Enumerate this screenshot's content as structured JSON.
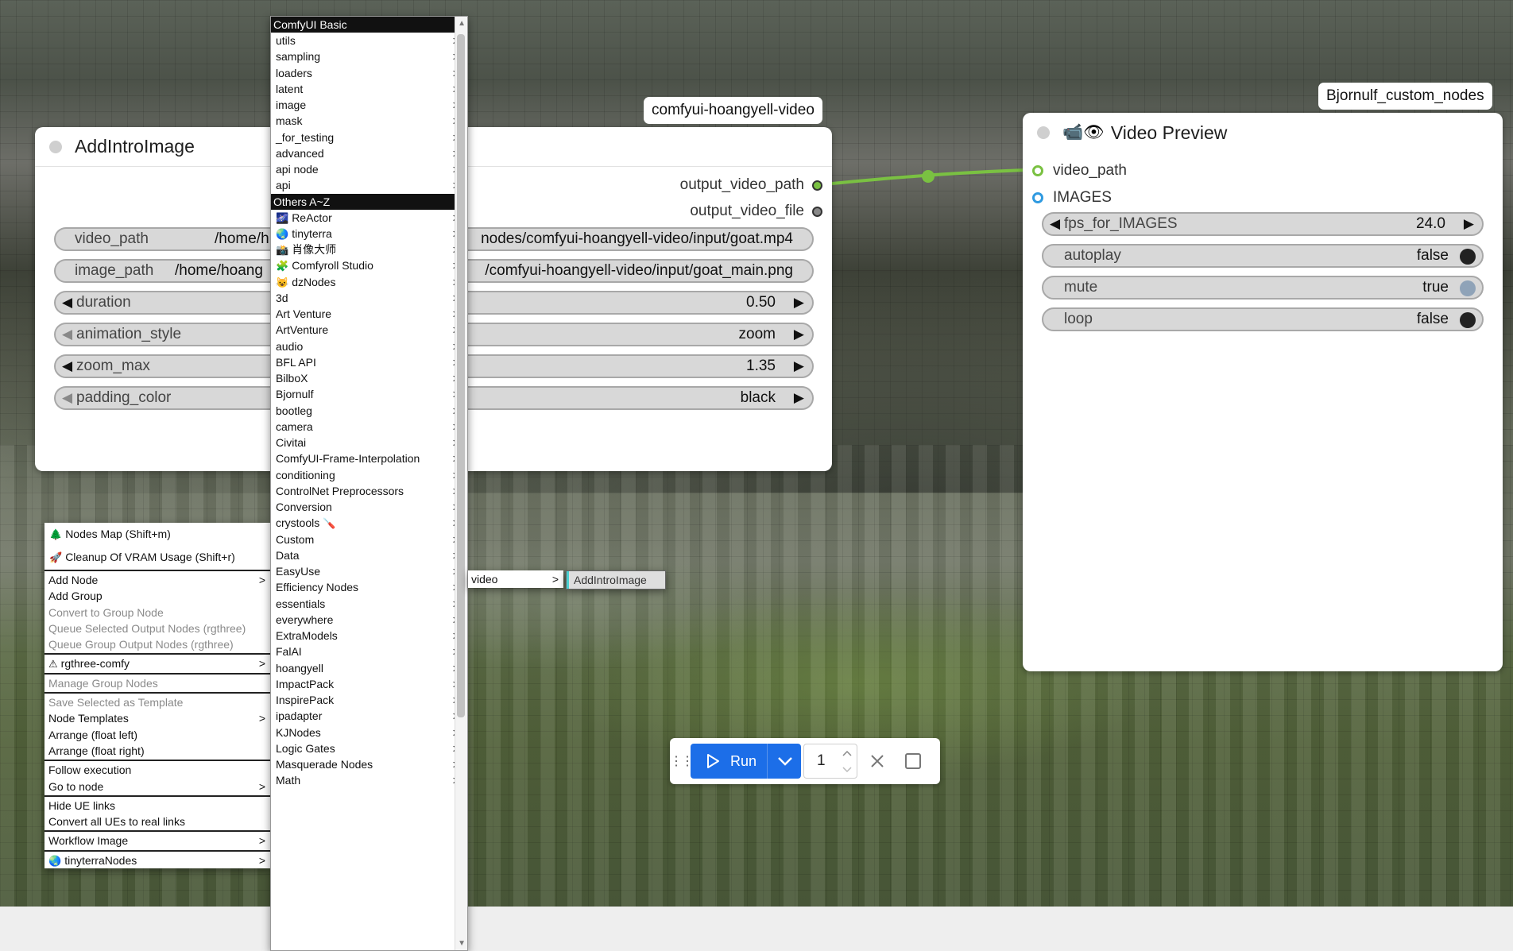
{
  "colors": {
    "link_green": "#7ac142",
    "images_blue": "#2f9ae0",
    "run_blue": "#1c6ee8",
    "menu_accent": "#4ad0d0"
  },
  "nodes": {
    "add_intro": {
      "title": "AddIntroImage",
      "badge": "comfyui-hoangyell-video",
      "outputs": [
        "output_video_path",
        "output_video_file"
      ],
      "widgets": [
        {
          "label": "video_path",
          "value": "/home/hoangyell/ComfyUI/custom_nodes/comfyui-hoangyell-video/input/goat.mp4",
          "visible_left": "/home/h",
          "visible_right": "nodes/comfyui-hoangyell-video/input/goat.mp4"
        },
        {
          "label": "image_path",
          "value": "/home/hoangyell/ComfyUI/custom_nodes/comfyui-hoangyell-video/input/goat_main.png",
          "visible_left": "/home/hoang",
          "visible_right": "/comfyui-hoangyell-video/input/goat_main.png"
        },
        {
          "label": "duration",
          "value": "0.50"
        },
        {
          "label": "animation_style",
          "value": "zoom"
        },
        {
          "label": "zoom_max",
          "value": "1.35"
        },
        {
          "label": "padding_color",
          "value": "black"
        }
      ]
    },
    "video_preview": {
      "title": "Video Preview",
      "icons": "📹👁",
      "badge": "Bjornulf_custom_nodes",
      "inputs": [
        "video_path",
        "IMAGES"
      ],
      "fps_label": "fps_for_IMAGES",
      "fps_value": "24.0",
      "toggles": [
        {
          "label": "autoplay",
          "value": "false"
        },
        {
          "label": "mute",
          "value": "true"
        },
        {
          "label": "loop",
          "value": "false"
        }
      ]
    }
  },
  "canvas_menu": {
    "top_items": [
      {
        "label": "Nodes Map (Shift+m)",
        "icon": "🌲"
      },
      {
        "label": "Cleanup Of VRAM Usage (Shift+r)",
        "icon": "🚀"
      }
    ],
    "groups": [
      [
        {
          "label": "Add Node",
          "sub": true
        },
        {
          "label": "Add Group"
        },
        {
          "label": "Convert to Group Node",
          "disabled": true
        },
        {
          "label": "Queue Selected Output Nodes (rgthree)",
          "disabled": true
        },
        {
          "label": "Queue Group Output Nodes (rgthree)",
          "disabled": true
        }
      ],
      [
        {
          "label": "rgthree-comfy",
          "sub": true,
          "icon": "⚠"
        }
      ],
      [
        {
          "label": "Manage Group Nodes",
          "disabled": true
        }
      ],
      [
        {
          "label": "Save Selected as Template",
          "disabled": true
        },
        {
          "label": "Node Templates",
          "sub": true
        },
        {
          "label": "Arrange (float left)"
        },
        {
          "label": "Arrange (float right)"
        }
      ],
      [
        {
          "label": "Follow execution"
        },
        {
          "label": "Go to node",
          "sub": true
        }
      ],
      [
        {
          "label": "Hide UE links"
        },
        {
          "label": "Convert all UEs to real links"
        }
      ],
      [
        {
          "label": "Workflow Image",
          "sub": true
        }
      ],
      [
        {
          "label": "tinyterraNodes",
          "sub": true,
          "icon": "🌏"
        }
      ]
    ]
  },
  "category_menu": {
    "header_basic": "ComfyUI Basic",
    "basic": [
      "utils",
      "sampling",
      "loaders",
      "latent",
      "image",
      "mask",
      "_for_testing",
      "advanced",
      "api node",
      "api"
    ],
    "header_others": "Others A~Z",
    "others": [
      {
        "label": "ReActor",
        "icon": "🌌"
      },
      {
        "label": "tinyterra",
        "icon": "🌏"
      },
      {
        "label": "肖像大师",
        "icon": "📸"
      },
      {
        "label": "Comfyroll Studio",
        "icon": "🧩"
      },
      {
        "label": "dzNodes",
        "icon": "😺"
      },
      {
        "label": "3d"
      },
      {
        "label": "Art Venture"
      },
      {
        "label": "ArtVenture"
      },
      {
        "label": "audio"
      },
      {
        "label": "BFL API"
      },
      {
        "label": "BilboX"
      },
      {
        "label": "Bjornulf"
      },
      {
        "label": "bootleg"
      },
      {
        "label": "camera"
      },
      {
        "label": "Civitai"
      },
      {
        "label": "ComfyUI-Frame-Interpolation"
      },
      {
        "label": "conditioning"
      },
      {
        "label": "ControlNet Preprocessors"
      },
      {
        "label": "Conversion"
      },
      {
        "label": "crystools",
        "suffix": "🪛"
      },
      {
        "label": "Custom"
      },
      {
        "label": "Data"
      },
      {
        "label": "EasyUse"
      },
      {
        "label": "Efficiency Nodes"
      },
      {
        "label": "essentials"
      },
      {
        "label": "everywhere"
      },
      {
        "label": "ExtraModels"
      },
      {
        "label": "FalAI"
      },
      {
        "label": "hoangyell"
      },
      {
        "label": "ImpactPack"
      },
      {
        "label": "InspirePack"
      },
      {
        "label": "ipadapter"
      },
      {
        "label": "KJNodes"
      },
      {
        "label": "Logic Gates"
      },
      {
        "label": "Masquerade Nodes"
      },
      {
        "label": "Math"
      }
    ],
    "chevron": ">"
  },
  "submenu": {
    "label": "video",
    "chevron": ">"
  },
  "leaf_menu": {
    "label": "AddIntroImage"
  },
  "runbar": {
    "run_label": "Run",
    "count": "1"
  }
}
